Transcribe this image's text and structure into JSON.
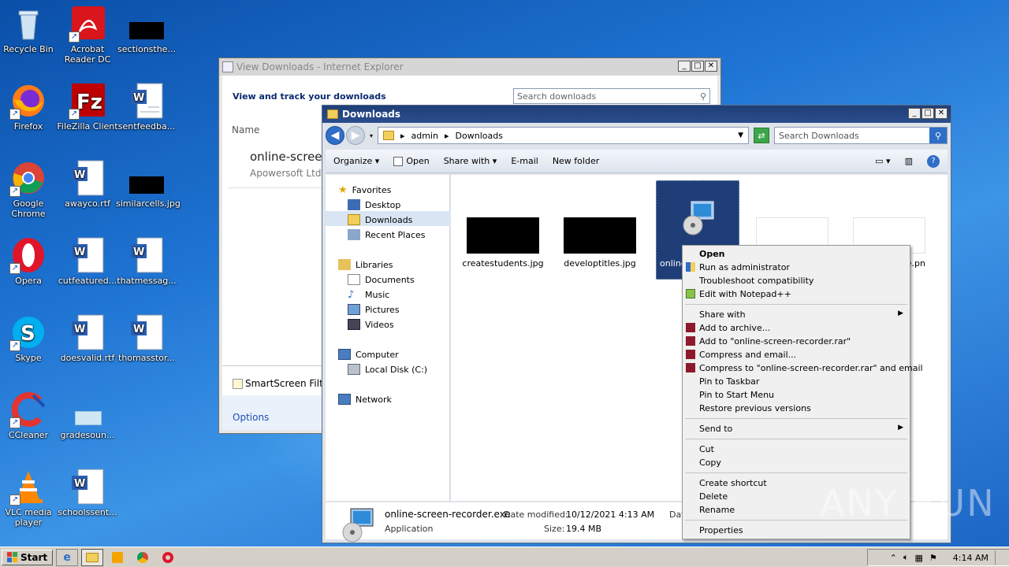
{
  "desktop": {
    "icons": [
      {
        "label": "Recycle Bin"
      },
      {
        "label": "Acrobat Reader DC"
      },
      {
        "label": "sectionsthe..."
      },
      {
        "label": "Firefox"
      },
      {
        "label": "FileZilla Client"
      },
      {
        "label": "sentfeedba..."
      },
      {
        "label": "Google Chrome"
      },
      {
        "label": "awayco.rtf"
      },
      {
        "label": "similarcells.jpg"
      },
      {
        "label": "Opera"
      },
      {
        "label": "cutfeatured..."
      },
      {
        "label": "thatmessag..."
      },
      {
        "label": "Skype"
      },
      {
        "label": "doesvalid.rtf"
      },
      {
        "label": "thomasstor..."
      },
      {
        "label": "CCleaner"
      },
      {
        "label": "gradesoun..."
      },
      {
        "label": "VLC media player"
      },
      {
        "label": "schoolssent..."
      }
    ]
  },
  "ie_window": {
    "title": "View Downloads - Internet Explorer",
    "header": "View and track your downloads",
    "search_placeholder": "Search downloads",
    "col_name": "Name",
    "item_name": "online-screen",
    "item_publisher": "Apowersoft Ltd",
    "smartscreen": "SmartScreen Filte",
    "options": "Options"
  },
  "explorer": {
    "title": "Downloads",
    "breadcrumb": [
      "admin",
      "Downloads"
    ],
    "search_placeholder": "Search Downloads",
    "toolbar": [
      "Organize",
      "Open",
      "Share with",
      "E-mail",
      "New folder"
    ],
    "nav": {
      "favorites": "Favorites",
      "desktop": "Desktop",
      "downloads": "Downloads",
      "recent": "Recent Places",
      "libraries": "Libraries",
      "documents": "Documents",
      "music": "Music",
      "pictures": "Pictures",
      "videos": "Videos",
      "computer": "Computer",
      "localdisk": "Local Disk (C:)",
      "network": "Network"
    },
    "files": [
      {
        "name": "createstudents.jpg"
      },
      {
        "name": "developtitles.jpg"
      },
      {
        "name": "online"
      },
      {
        "name": "e.pn"
      }
    ],
    "details": {
      "name": "online-screen-recorder.exe",
      "type": "Application",
      "modified_label": "Date modified:",
      "modified": "10/12/2021 4:13 AM",
      "size_label": "Size:",
      "size": "19.4 MB",
      "extra": "Dat"
    }
  },
  "context_menu": {
    "items": [
      {
        "label": "Open",
        "bold": true
      },
      {
        "label": "Run as administrator"
      },
      {
        "label": "Troubleshoot compatibility"
      },
      {
        "label": "Edit with Notepad++"
      },
      {
        "label": "Share with"
      },
      {
        "label": "Add to archive..."
      },
      {
        "label": "Add to \"online-screen-recorder.rar\""
      },
      {
        "label": "Compress and email..."
      },
      {
        "label": "Compress to \"online-screen-recorder.rar\" and email"
      },
      {
        "label": "Pin to Taskbar"
      },
      {
        "label": "Pin to Start Menu"
      },
      {
        "label": "Restore previous versions"
      },
      {
        "label": "Send to"
      },
      {
        "label": "Cut"
      },
      {
        "label": "Copy"
      },
      {
        "label": "Create shortcut"
      },
      {
        "label": "Delete"
      },
      {
        "label": "Rename"
      },
      {
        "label": "Properties"
      }
    ]
  },
  "taskbar": {
    "start": "Start",
    "clock": "4:14 AM"
  },
  "watermark": "ANY RUN",
  "colors": {
    "desktop_bg": "#1e73d2",
    "explorer_title": "#2a4d8e",
    "selection": "#1f3e77"
  }
}
